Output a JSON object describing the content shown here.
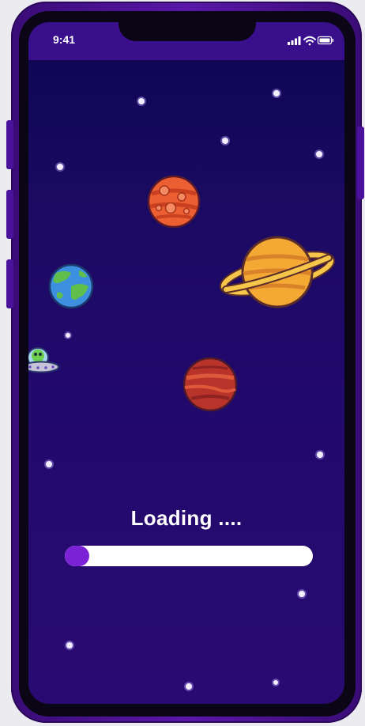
{
  "status_bar": {
    "time": "9:41",
    "signal_icon": "cellular-signal-icon",
    "wifi_icon": "wifi-icon",
    "battery_icon": "battery-icon"
  },
  "scene": {
    "illustrations": [
      "mars-planet",
      "earth-planet",
      "saturn-planet",
      "red-planet",
      "alien-ufo"
    ]
  },
  "loading": {
    "text": "Loading ....",
    "progress": 0.1
  },
  "colors": {
    "status_bar": "#3a0f8c",
    "background_top": "#0c0550",
    "background_bottom": "#290a72",
    "progress_fill": "#7b22d6",
    "progress_track": "#ffffff",
    "frame": "#4a129a"
  }
}
